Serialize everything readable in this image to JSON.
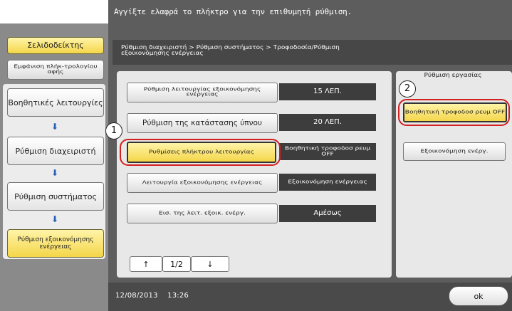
{
  "instruction": "Αγγίξτε ελαφρά το πλήκτρο για την επιθυμητή ρύθμιση.",
  "sidebar": {
    "bookmark_label": "Σελιδοδείκτης",
    "show_function_label": "Εμφάνιση πλήκ-τρολογίου αφής",
    "nav": [
      {
        "label": "Βοηθητικές λειτουργίες"
      },
      {
        "label": "Ρύθμιση διαχειριστή"
      },
      {
        "label": "Ρύθμιση συστήματος"
      },
      {
        "label": "Ρύθμιση εξοικονόμησης ενέργειας"
      }
    ]
  },
  "breadcrumb": "Ρύθμιση διαχειριστή > Ρύθμιση συστήματος > Τροφοδοσία/Ρύθμιση εξοικονόμησης ενέργειας",
  "settings": [
    {
      "label": "Ρύθμιση λειτουργίας εξοικονόμησης ενέργειας",
      "value": "15 ΛΕΠ."
    },
    {
      "label": "Ρύθμιση της κατάστασης ύπνου",
      "value": "20 ΛΕΠ."
    },
    {
      "label": "Ρυθμίσεις πλήκτρου λειτουργίας",
      "value": "Βοηθητική τροφοδοσ ρευμ OFF"
    },
    {
      "label": "Λειτουργία εξοικονόμησης ενέργειας",
      "value": "Εξοικονόμηση ενέργειας"
    },
    {
      "label": "Εισ. της λειτ. εξοικ. ενέργ.",
      "value": "Αμέσως"
    }
  ],
  "pager": {
    "page": "1/2",
    "up": "↑",
    "down": "↓"
  },
  "right_panel": {
    "title": "Ρύθμιση εργασίας",
    "options": [
      {
        "label": "Βοηθητική τροφοδοσ ρευμ OFF",
        "selected": true
      },
      {
        "label": "Εξοικονόμηση ενέργ.",
        "selected": false
      }
    ]
  },
  "callouts": [
    "1",
    "2"
  ],
  "footer": {
    "date": "12/08/2013",
    "time": "13:26",
    "ok_label": "ok"
  },
  "colors": {
    "highlight": "#f4d64a",
    "callout_ring": "#d41f1f",
    "screen_bg": "#5d5d5d",
    "arrow": "#2a5fb8"
  }
}
